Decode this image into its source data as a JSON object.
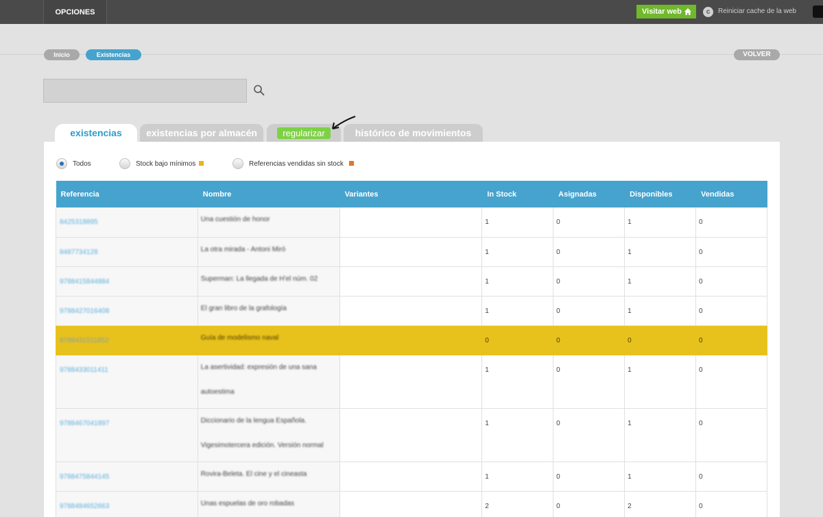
{
  "topbar": {
    "menu_label": "OPCIONES",
    "visit_label": "Visitar web",
    "visit_icon": "home-icon",
    "reset_label": "Reiniciar cache de la web",
    "reset_icon": "c-circle-icon",
    "accent": "#70b82c"
  },
  "breadcrumb": {
    "inicio": "Inicio",
    "current": "Existencias",
    "back": "VOLVER"
  },
  "search": {
    "value": "",
    "icon": "search-icon"
  },
  "tabs": [
    {
      "label": "existencias",
      "active": true
    },
    {
      "label": "existencias por almacén",
      "active": false
    },
    {
      "label": "regularizar",
      "active": false
    },
    {
      "label": "histórico de movimientos",
      "active": false
    }
  ],
  "filters": [
    {
      "label": "Todos",
      "selected": true
    },
    {
      "label": "Stock bajo mínimos",
      "color": "#e7b818",
      "selected": false
    },
    {
      "label": "Referencias vendidas sin stock",
      "color": "#e1762a",
      "selected": false
    }
  ],
  "table": {
    "columns": [
      "Referencia",
      "Nombre",
      "Variantes",
      "In Stock",
      "Asignadas",
      "Disponibles",
      "Vendidas"
    ],
    "header_color": "#46a3cd",
    "highlight_color": "#e8c21c",
    "rows": [
      {
        "ref": "8425318895",
        "nombre": "Una cuestión de honor",
        "variantes": "",
        "stock": "1",
        "asignadas": "0",
        "disponibles": "1",
        "vendidas": "0"
      },
      {
        "ref": "8487734128",
        "nombre": "La otra mirada - Antoni Miró",
        "variantes": "",
        "stock": "1",
        "asignadas": "0",
        "disponibles": "1",
        "vendidas": "0"
      },
      {
        "ref": "9788415844884",
        "nombre": "Superman: La llegada de H'el núm. 02",
        "variantes": "",
        "stock": "1",
        "asignadas": "0",
        "disponibles": "1",
        "vendidas": "0"
      },
      {
        "ref": "9788427016408",
        "nombre": "El gran libro de la grafología",
        "variantes": "",
        "stock": "1",
        "asignadas": "0",
        "disponibles": "1",
        "vendidas": "0"
      },
      {
        "ref": "9788431511852",
        "nombre": "Guía de modelismo naval",
        "variantes": "",
        "stock": "0",
        "asignadas": "0",
        "disponibles": "0",
        "vendidas": "0",
        "highlight": true
      },
      {
        "ref": "9788433011411",
        "nombre_1": "La asertividad: expresión de una sana",
        "nombre_2": "autoestima",
        "variantes": "",
        "stock": "1",
        "asignadas": "0",
        "disponibles": "1",
        "vendidas": "0"
      },
      {
        "ref": "9788467041897",
        "nombre_1": "Diccionario de la lengua Española.",
        "nombre_2": "Vigesimotercera edición. Versión normal",
        "variantes": "",
        "stock": "1",
        "asignadas": "0",
        "disponibles": "1",
        "vendidas": "0"
      },
      {
        "ref": "9788475844145",
        "nombre": "Rovira-Beleta. El cine y el cineasta",
        "variantes": "",
        "stock": "1",
        "asignadas": "0",
        "disponibles": "1",
        "vendidas": "0"
      },
      {
        "ref": "9788484652663",
        "nombre": "Unas espuelas de oro robadas",
        "variantes": "",
        "stock": "2",
        "asignadas": "0",
        "disponibles": "2",
        "vendidas": "0"
      }
    ]
  }
}
